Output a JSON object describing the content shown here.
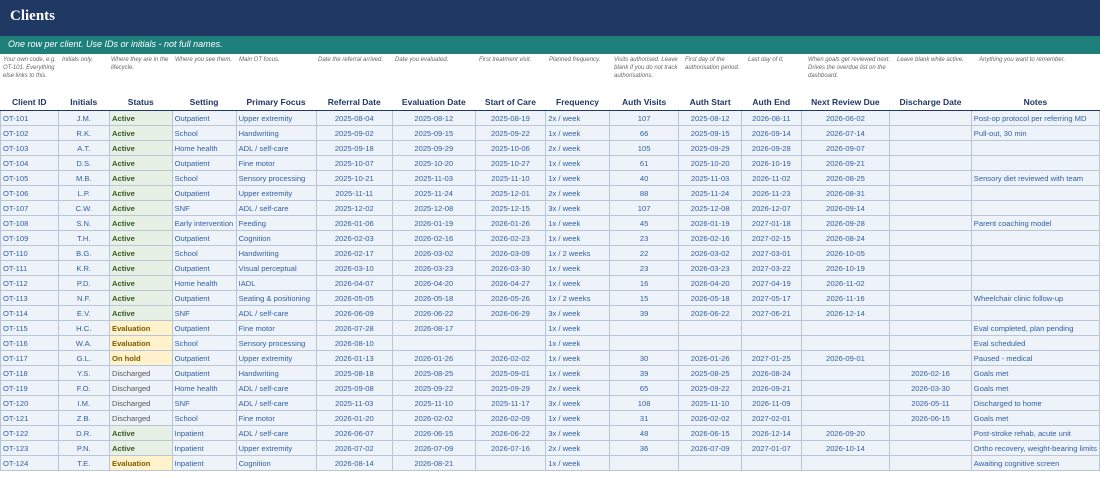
{
  "sheet": {
    "title": "Clients",
    "subtitle": "One row per client. Use IDs or initials - not full names."
  },
  "hints": [
    "Your own code, e.g. OT-101. Everything else links to this.",
    "Initials only.",
    "Where they are in the lifecycle.",
    "Where you see them.",
    "Main OT focus.",
    "Date the referral arrived.",
    "Date you evaluated.",
    "First treatment visit.",
    "Planned frequency.",
    "Visits authorised. Leave blank if you do not track authorisations.",
    "First day of the authorisation period.",
    "Last day of it.",
    "When goals get reviewed next. Drives the overdue list on the dashboard.",
    "Leave blank while active.",
    "Anything you want to remember."
  ],
  "columns": [
    "Client ID",
    "Initials",
    "Status",
    "Setting",
    "Primary Focus",
    "Referral Date",
    "Evaluation Date",
    "Start of Care",
    "Frequency",
    "Auth Visits",
    "Auth Start",
    "Auth End",
    "Next Review Due",
    "Discharge Date",
    "Notes"
  ],
  "rows": [
    [
      "OT-101",
      "J.M.",
      "Active",
      "Outpatient",
      "Upper extremity",
      "2025-08-04",
      "2025-08-12",
      "2025-08-19",
      "2x / week",
      "107",
      "2025-08-12",
      "2026-08-11",
      "2026-06-02",
      "",
      "Post-op protocol per referring MD"
    ],
    [
      "OT-102",
      "R.K.",
      "Active",
      "School",
      "Handwriting",
      "2025-09-02",
      "2025-09-15",
      "2025-09-22",
      "1x / week",
      "66",
      "2025-09-15",
      "2026-09-14",
      "2026-07-14",
      "",
      "Pull-out, 30 min"
    ],
    [
      "OT-103",
      "A.T.",
      "Active",
      "Home health",
      "ADL / self-care",
      "2025-09-18",
      "2025-09-29",
      "2025-10-06",
      "2x / week",
      "105",
      "2025-09-29",
      "2026-09-28",
      "2026-09-07",
      "",
      ""
    ],
    [
      "OT-104",
      "D.S.",
      "Active",
      "Outpatient",
      "Fine motor",
      "2025-10-07",
      "2025-10-20",
      "2025-10-27",
      "1x / week",
      "61",
      "2025-10-20",
      "2026-10-19",
      "2026-09-21",
      "",
      ""
    ],
    [
      "OT-105",
      "M.B.",
      "Active",
      "School",
      "Sensory processing",
      "2025-10-21",
      "2025-11-03",
      "2025-11-10",
      "1x / week",
      "40",
      "2025-11-03",
      "2026-11-02",
      "2026-08-25",
      "",
      "Sensory diet reviewed with team"
    ],
    [
      "OT-106",
      "L.P.",
      "Active",
      "Outpatient",
      "Upper extremity",
      "2025-11-11",
      "2025-11-24",
      "2025-12-01",
      "2x / week",
      "88",
      "2025-11-24",
      "2026-11-23",
      "2026-08-31",
      "",
      ""
    ],
    [
      "OT-107",
      "C.W.",
      "Active",
      "SNF",
      "ADL / self-care",
      "2025-12-02",
      "2025-12-08",
      "2025-12-15",
      "3x / week",
      "107",
      "2025-12-08",
      "2026-12-07",
      "2026-09-14",
      "",
      ""
    ],
    [
      "OT-108",
      "S.N.",
      "Active",
      "Early intervention",
      "Feeding",
      "2026-01-06",
      "2026-01-19",
      "2026-01-26",
      "1x / week",
      "45",
      "2026-01-19",
      "2027-01-18",
      "2026-09-28",
      "",
      "Parent coaching model"
    ],
    [
      "OT-109",
      "T.H.",
      "Active",
      "Outpatient",
      "Cognition",
      "2026-02-03",
      "2026-02-16",
      "2026-02-23",
      "1x / week",
      "23",
      "2026-02-16",
      "2027-02-15",
      "2026-08-24",
      "",
      ""
    ],
    [
      "OT-110",
      "B.G.",
      "Active",
      "School",
      "Handwriting",
      "2026-02-17",
      "2026-03-02",
      "2026-03-09",
      "1x / 2 weeks",
      "22",
      "2026-03-02",
      "2027-03-01",
      "2026-10-05",
      "",
      ""
    ],
    [
      "OT-111",
      "K.R.",
      "Active",
      "Outpatient",
      "Visual perceptual",
      "2026-03-10",
      "2026-03-23",
      "2026-03-30",
      "1x / week",
      "23",
      "2026-03-23",
      "2027-03-22",
      "2026-10-19",
      "",
      ""
    ],
    [
      "OT-112",
      "P.D.",
      "Active",
      "Home health",
      "IADL",
      "2026-04-07",
      "2026-04-20",
      "2026-04-27",
      "1x / week",
      "16",
      "2026-04-20",
      "2027-04-19",
      "2026-11-02",
      "",
      ""
    ],
    [
      "OT-113",
      "N.F.",
      "Active",
      "Outpatient",
      "Seating & positioning",
      "2026-05-05",
      "2026-05-18",
      "2026-05-26",
      "1x / 2 weeks",
      "15",
      "2026-05-18",
      "2027-05-17",
      "2026-11-16",
      "",
      "Wheelchair clinic follow-up"
    ],
    [
      "OT-114",
      "E.V.",
      "Active",
      "SNF",
      "ADL / self-care",
      "2026-06-09",
      "2026-06-22",
      "2026-06-29",
      "3x / week",
      "39",
      "2026-06-22",
      "2027-06-21",
      "2026-12-14",
      "",
      ""
    ],
    [
      "OT-115",
      "H.C.",
      "Evaluation",
      "Outpatient",
      "Fine motor",
      "2026-07-28",
      "2026-08-17",
      "",
      "1x / week",
      "",
      "",
      "",
      "",
      "",
      "Eval completed, plan pending"
    ],
    [
      "OT-116",
      "W.A.",
      "Evaluation",
      "School",
      "Sensory processing",
      "2026-08-10",
      "",
      "",
      "1x / week",
      "",
      "",
      "",
      "",
      "",
      "Eval scheduled"
    ],
    [
      "OT-117",
      "G.L.",
      "On hold",
      "Outpatient",
      "Upper extremity",
      "2026-01-13",
      "2026-01-26",
      "2026-02-02",
      "1x / week",
      "30",
      "2026-01-26",
      "2027-01-25",
      "2026-09-01",
      "",
      "Paused - medical"
    ],
    [
      "OT-118",
      "Y.S.",
      "Discharged",
      "Outpatient",
      "Handwriting",
      "2025-08-18",
      "2025-08-25",
      "2025-09-01",
      "1x / week",
      "39",
      "2025-08-25",
      "2026-08-24",
      "",
      "2026-02-16",
      "Goals met"
    ],
    [
      "OT-119",
      "F.O.",
      "Discharged",
      "Home health",
      "ADL / self-care",
      "2025-09-08",
      "2025-09-22",
      "2025-09-29",
      "2x / week",
      "65",
      "2025-09-22",
      "2026-09-21",
      "",
      "2026-03-30",
      "Goals met"
    ],
    [
      "OT-120",
      "I.M.",
      "Discharged",
      "SNF",
      "ADL / self-care",
      "2025-11-03",
      "2025-11-10",
      "2025-11-17",
      "3x / week",
      "108",
      "2025-11-10",
      "2026-11-09",
      "",
      "2026-05-11",
      "Discharged to home"
    ],
    [
      "OT-121",
      "Z.B.",
      "Discharged",
      "School",
      "Fine motor",
      "2026-01-20",
      "2026-02-02",
      "2026-02-09",
      "1x / week",
      "31",
      "2026-02-02",
      "2027-02-01",
      "",
      "2026-06-15",
      "Goals met"
    ],
    [
      "OT-122",
      "D.R.",
      "Active",
      "Inpatient",
      "ADL / self-care",
      "2026-06-07",
      "2026-06-15",
      "2026-06-22",
      "3x / week",
      "48",
      "2026-06-15",
      "2026-12-14",
      "2026-09-20",
      "",
      "Post-stroke rehab, acute unit"
    ],
    [
      "OT-123",
      "P.N.",
      "Active",
      "Inpatient",
      "Upper extremity",
      "2026-07-02",
      "2026-07-09",
      "2026-07-16",
      "2x / week",
      "36",
      "2026-07-09",
      "2027-01-07",
      "2026-10-14",
      "",
      "Ortho recovery, weight-bearing limits"
    ],
    [
      "OT-124",
      "T.E.",
      "Evaluation",
      "Inpatient",
      "Cognition",
      "2026-08-14",
      "2026-08-21",
      "",
      "1x / week",
      "",
      "",
      "",
      "",
      "",
      "Awaiting cognitive screen"
    ]
  ]
}
